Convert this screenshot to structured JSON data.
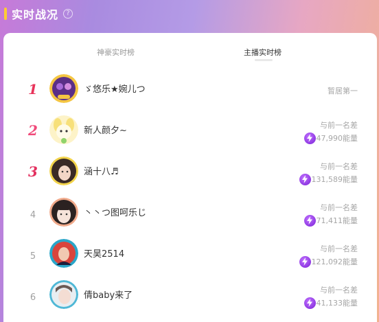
{
  "header": {
    "title": "实时战况",
    "help_icon": "question-icon",
    "accent_color": "#ffcc33"
  },
  "tabs": [
    {
      "label": "神豪实时榜",
      "active": false
    },
    {
      "label": "主播实时榜",
      "active": true
    }
  ],
  "ranking": [
    {
      "rank": "1",
      "name": "ゞ悠乐★婉儿つ",
      "status": "暂居第一"
    },
    {
      "rank": "2",
      "name": "新人颜夕~",
      "diff_label": "与前一名差",
      "energy": "47,990能量"
    },
    {
      "rank": "3",
      "name": "涵十八♬",
      "diff_label": "与前一名差",
      "energy": "131,589能量"
    },
    {
      "rank": "4",
      "name": "丶丶つ图呵乐じ",
      "diff_label": "与前一名差",
      "energy": "71,411能量"
    },
    {
      "rank": "5",
      "name": "天昊2514",
      "diff_label": "与前一名差",
      "energy": "121,092能量"
    },
    {
      "rank": "6",
      "name": "倩baby来了",
      "diff_label": "与前一名差",
      "energy": "41,133能量"
    }
  ],
  "colors": {
    "rank_top": "#e8335a",
    "energy_icon": "#8a2be2"
  }
}
